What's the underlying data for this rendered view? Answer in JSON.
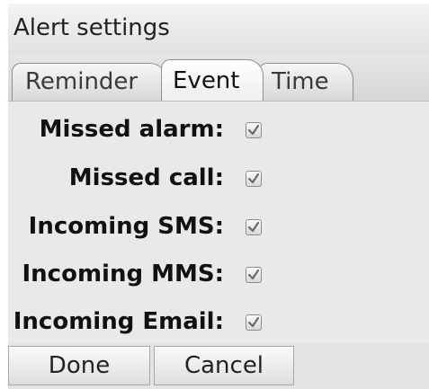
{
  "window": {
    "title": "Alert settings"
  },
  "tabs": [
    {
      "label": "Reminder",
      "active": false
    },
    {
      "label": "Event",
      "active": true
    },
    {
      "label": "Time",
      "active": false
    }
  ],
  "event_settings": [
    {
      "label": "Missed alarm:",
      "checked": true
    },
    {
      "label": "Missed call:",
      "checked": true
    },
    {
      "label": "Incoming SMS:",
      "checked": true
    },
    {
      "label": "Incoming MMS:",
      "checked": true
    },
    {
      "label": "Incoming Email:",
      "checked": true
    }
  ],
  "buttons": {
    "done": "Done",
    "cancel": "Cancel"
  },
  "icons": {
    "checkbox_mark": "checkmark-icon"
  },
  "colors": {
    "background": "#e9e9e9",
    "text": "#111111",
    "checkmark": "#6a6a6a"
  }
}
